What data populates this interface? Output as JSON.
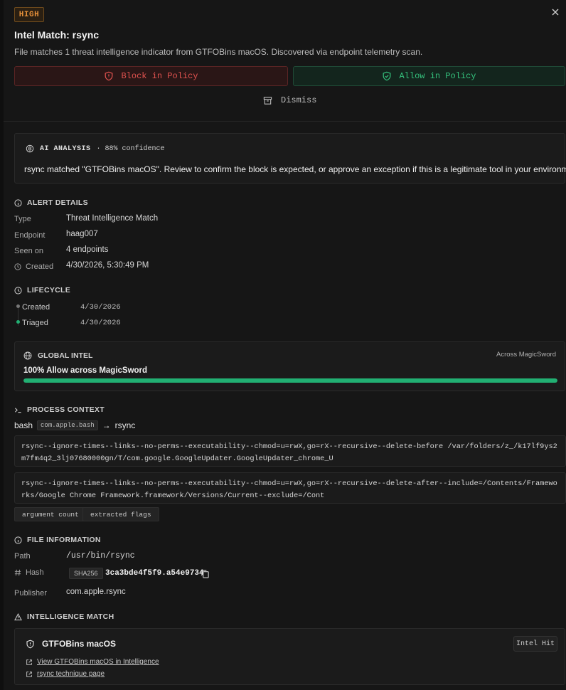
{
  "header": {
    "severity": "HIGH",
    "title": "Intel Match: rsync",
    "subtitle": "File matches 1 threat intelligence indicator from GTFOBins macOS. Discovered via endpoint telemetry scan."
  },
  "actions": {
    "block_label": "Block in Policy",
    "allow_label": "Allow in Policy",
    "dismiss_label": "Dismiss"
  },
  "ai_analysis": {
    "title": "AI ANALYSIS",
    "confidence": "· 88% confidence",
    "text": "rsync matched \"GTFOBins macOS\". Review to confirm the block is expected, or approve an exception if this is a legitimate tool in your environment."
  },
  "alert_details": {
    "title": "ALERT DETAILS",
    "rows": [
      {
        "label": "Type",
        "value": "Threat Intelligence Match"
      },
      {
        "label": "Endpoint",
        "value": "haag007"
      },
      {
        "label": "Seen on",
        "value": "4 endpoints"
      },
      {
        "label": "Created",
        "value": "4/30/2026, 5:30:49 PM"
      }
    ]
  },
  "lifecycle": {
    "title": "LIFECYCLE",
    "events": [
      {
        "label": "Created",
        "date": "4/30/2026"
      },
      {
        "label": "Triaged",
        "date": "4/30/2026"
      }
    ]
  },
  "global_intel": {
    "title": "GLOBAL INTEL",
    "scope": "Across MagicSword",
    "summary": "100% Allow across MagicSword",
    "allow_fraction": 1.0
  },
  "process_context": {
    "title": "PROCESS CONTEXT",
    "parent": "bash",
    "parent_bundle": "com.apple.bash",
    "arrow": "→",
    "child": "rsync",
    "commands": [
      "rsync--ignore-times--links--no-perms--executability--chmod=u=rwX,go=rX--recursive--delete-before /var/folders/z_/k17lf9ys2m7fm4q2_3lj07680000gn/T/com.google.GoogleUpdater.GoogleUpdater_chrome_U",
      "rsync--ignore-times--links--no-perms--executability--chmod=u=rwX,go=rX--recursive--delete-after--include=/Contents/Frameworks/Google Chrome Framework.framework/Versions/Current--exclude=/Cont"
    ],
    "tags": [
      "argument count",
      "extracted flags"
    ]
  },
  "file_info": {
    "title": "FILE INFORMATION",
    "path_label": "Path",
    "path": "/usr/bin/rsync",
    "hash_label": "Hash",
    "hash_algo": "SHA256",
    "hash": "3ca3bde4f5f9.a54e9734",
    "publisher_label": "Publisher",
    "publisher": "com.apple.rsync"
  },
  "intel_match": {
    "title": "INTELLIGENCE MATCH",
    "source": "GTFOBins macOS",
    "badge": "Intel Hit",
    "links": [
      "View GTFOBins macOS in Intelligence",
      "rsync technique page"
    ]
  },
  "colors": {
    "severity": "#e8913a",
    "block": "#e0524f",
    "allow": "#34c07c",
    "intel_bar": "#22b073"
  },
  "icons": [
    "close-icon",
    "shield-alert-icon",
    "shield-check-icon",
    "archive-icon",
    "brain-icon",
    "info-icon",
    "clock-icon",
    "globe-icon",
    "terminal-icon",
    "hash-icon",
    "copy-icon",
    "warning-icon",
    "external-link-icon"
  ]
}
